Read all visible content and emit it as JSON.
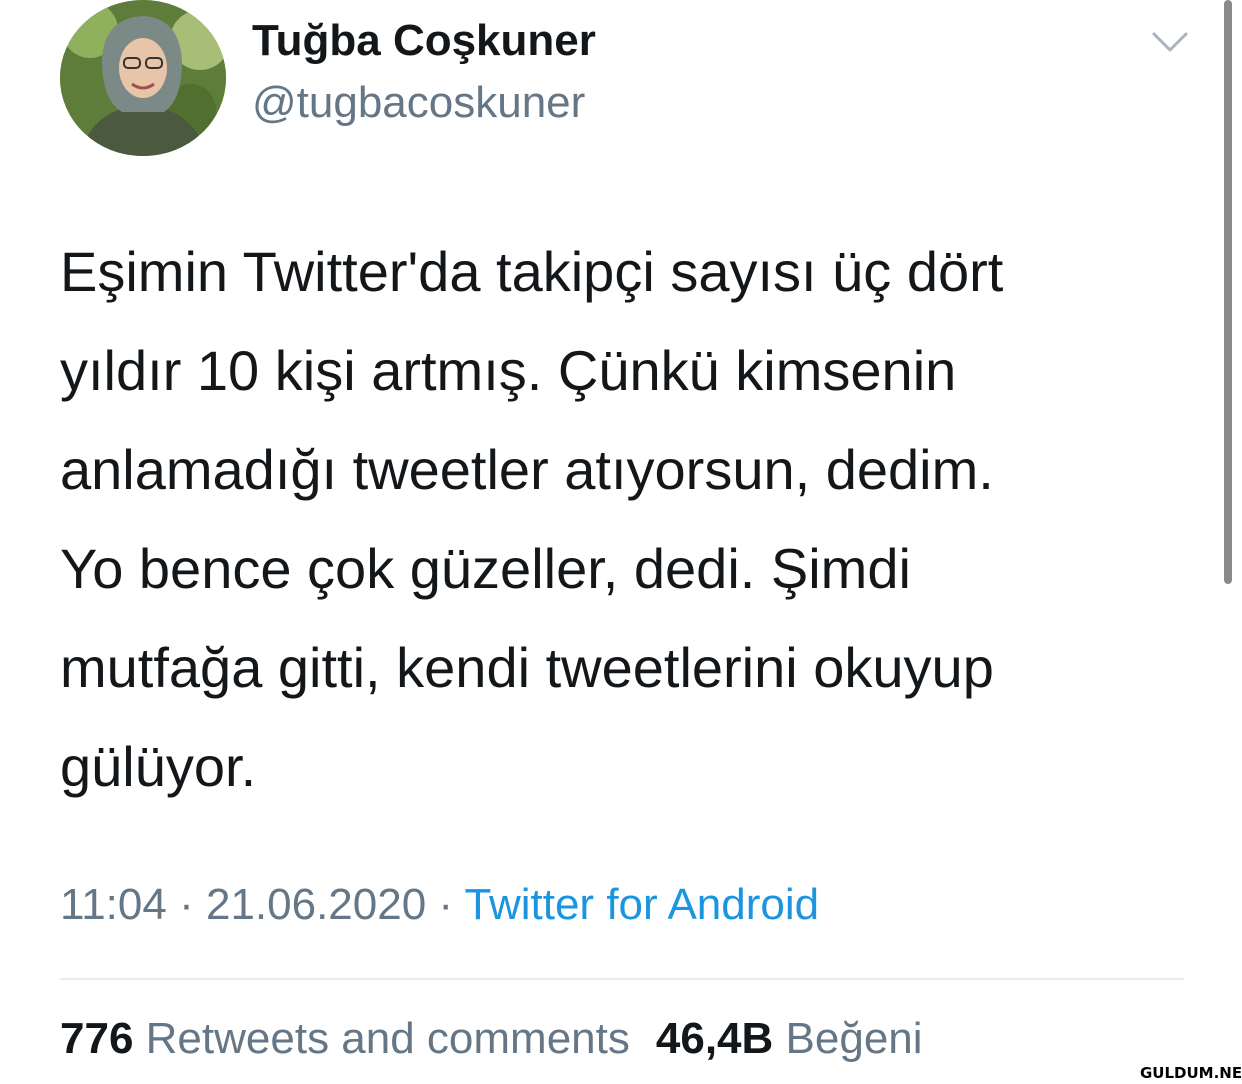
{
  "user": {
    "display_name": "Tuğba Coşkuner",
    "handle": "@tugbacoskuner"
  },
  "tweet": {
    "lines": [
      "Eşimin Twitter'da takipçi sayısı üç dört",
      "yıldır 10 kişi artmış. Çünkü kimsenin",
      "anlamadığı tweetler atıyorsun, dedim.",
      "Yo bence çok güzeller, dedi. Şimdi",
      "mutfağa gitti, kendi tweetlerini okuyup",
      "gülüyor."
    ]
  },
  "meta": {
    "time": "11:04",
    "separator": "·",
    "date": "21.06.2020",
    "source": "Twitter for Android"
  },
  "stats": {
    "retweets_count": "776",
    "retweets_label": "Retweets and comments",
    "likes_count": "46,4B",
    "likes_label": "Beğeni"
  },
  "icons": {
    "menu": "chevron-down-icon"
  },
  "watermark": "GULDUM.NET",
  "colors": {
    "text": "#14171a",
    "secondary": "#657786",
    "link": "#1b95e0",
    "divider": "#e6ecf0"
  }
}
